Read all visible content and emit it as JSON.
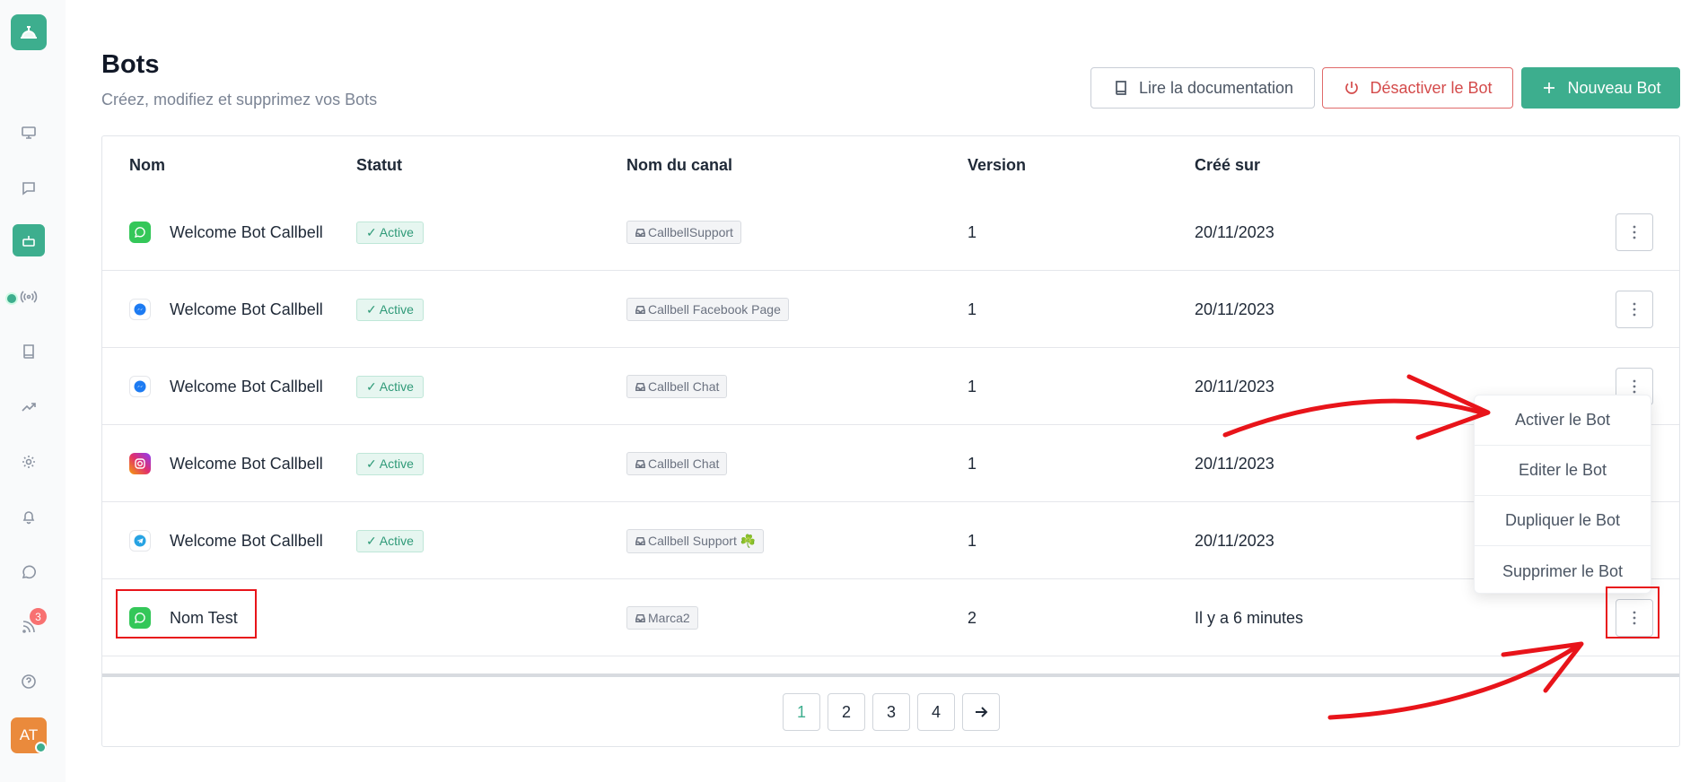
{
  "sidebar": {
    "logo": "bell-logo-icon",
    "items": [
      {
        "icon": "monitor-icon"
      },
      {
        "icon": "chat-icon"
      },
      {
        "icon": "bot-icon",
        "active": true
      },
      {
        "icon": "broadcast-icon"
      },
      {
        "icon": "book-icon"
      },
      {
        "icon": "trending-icon"
      },
      {
        "icon": "gear-icon"
      },
      {
        "icon": "bell-icon"
      },
      {
        "icon": "whatsapp-icon"
      },
      {
        "icon": "rss-icon",
        "badge": "3"
      },
      {
        "icon": "help-icon"
      }
    ],
    "avatar_initials": "AT"
  },
  "header": {
    "title": "Bots",
    "subtitle": "Créez, modifiez et supprimez vos Bots",
    "doc_button": "Lire la documentation",
    "deactivate_button": "Désactiver le Bot",
    "new_button": "Nouveau Bot"
  },
  "table": {
    "columns": [
      "Nom",
      "Statut",
      "Nom du canal",
      "Version",
      "Créé sur"
    ],
    "rows": [
      {
        "channel_icon": "whatsapp",
        "name": "Welcome Bot Callbell",
        "status": "Active",
        "canal": "CallbellSupport",
        "version": "1",
        "created": "20/11/2023"
      },
      {
        "channel_icon": "messenger",
        "name": "Welcome Bot Callbell",
        "status": "Active",
        "canal": "Callbell Facebook Page",
        "version": "1",
        "created": "20/11/2023"
      },
      {
        "channel_icon": "messenger",
        "name": "Welcome Bot Callbell",
        "status": "Active",
        "canal": "Callbell Chat",
        "version": "1",
        "created": "20/11/2023"
      },
      {
        "channel_icon": "instagram",
        "name": "Welcome Bot Callbell",
        "status": "Active",
        "canal": "Callbell Chat",
        "version": "1",
        "created": "20/11/2023"
      },
      {
        "channel_icon": "telegram",
        "name": "Welcome Bot Callbell",
        "status": "Active",
        "canal": "Callbell Support ☘️",
        "version": "1",
        "created": "20/11/2023"
      },
      {
        "channel_icon": "whatsapp",
        "name": "Nom Test",
        "status": "",
        "canal": "Marca2",
        "version": "2",
        "created": "Il y a 6 minutes"
      }
    ]
  },
  "pagination": {
    "pages": [
      "1",
      "2",
      "3",
      "4"
    ],
    "current": "1"
  },
  "dropdown": {
    "items": [
      "Activer le Bot",
      "Editer le Bot",
      "Dupliquer le Bot",
      "Supprimer le Bot"
    ]
  },
  "colors": {
    "accent": "#3dae8e",
    "danger": "#d44b4b",
    "annotation": "#e8141a"
  }
}
